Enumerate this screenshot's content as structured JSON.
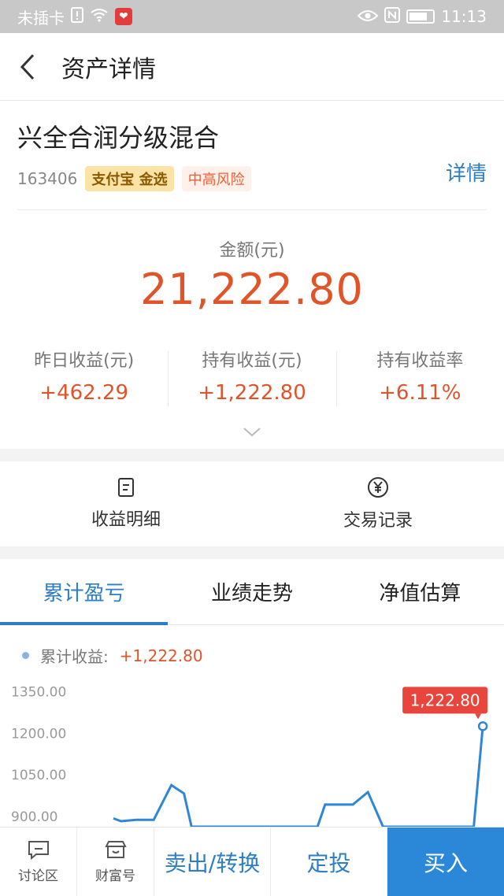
{
  "status_bar": {
    "carrier": "未插卡",
    "time": "11:13"
  },
  "nav": {
    "title": "资产详情"
  },
  "fund": {
    "name": "兴全合润分级混合",
    "code": "163406",
    "badge": "支付宝 金选",
    "risk": "中高风险",
    "detail_link": "详情"
  },
  "amount": {
    "label": "金额(元)",
    "value": "21,222.80"
  },
  "stats": [
    {
      "label": "昨日收益(元)",
      "value": "+462.29"
    },
    {
      "label": "持有收益(元)",
      "value": "+1,222.80"
    },
    {
      "label": "持有收益率",
      "value": "+6.11%"
    }
  ],
  "actions": [
    {
      "label": "收益明细",
      "icon": "document-icon"
    },
    {
      "label": "交易记录",
      "icon": "yen-circle-icon"
    }
  ],
  "tabs": [
    {
      "label": "累计盈亏",
      "active": true
    },
    {
      "label": "业绩走势",
      "active": false
    },
    {
      "label": "净值估算",
      "active": false
    }
  ],
  "legend": {
    "label": "累计收益:",
    "value": "+1,222.80"
  },
  "chart_data": {
    "type": "line",
    "y_ticks": [
      "1350.00",
      "1200.00",
      "1050.00",
      "900.00"
    ],
    "ylim": [
      860,
      1400
    ],
    "points": [
      {
        "x": 0.0,
        "y": null
      },
      {
        "x": 0.225,
        "y": 890
      },
      {
        "x": 0.24,
        "y": 880
      },
      {
        "x": 0.27,
        "y": 885
      },
      {
        "x": 0.305,
        "y": 885
      },
      {
        "x": 0.34,
        "y": 1010
      },
      {
        "x": 0.365,
        "y": 980
      },
      {
        "x": 0.38,
        "y": 860
      },
      {
        "x": 0.63,
        "y": 860
      },
      {
        "x": 0.645,
        "y": 940
      },
      {
        "x": 0.68,
        "y": 940
      },
      {
        "x": 0.7,
        "y": 940
      },
      {
        "x": 0.73,
        "y": 985
      },
      {
        "x": 0.76,
        "y": 860
      },
      {
        "x": 0.94,
        "y": 860
      },
      {
        "x": 0.958,
        "y": 1222.8
      }
    ],
    "annotation": "1,222.80",
    "line_color": "#2e86d6",
    "annotation_color": "#e8453c"
  },
  "bottom_bar": {
    "forum": "讨论区",
    "wealth": "财富号",
    "sell": "卖出/转换",
    "fixed": "定投",
    "buy": "买入"
  }
}
